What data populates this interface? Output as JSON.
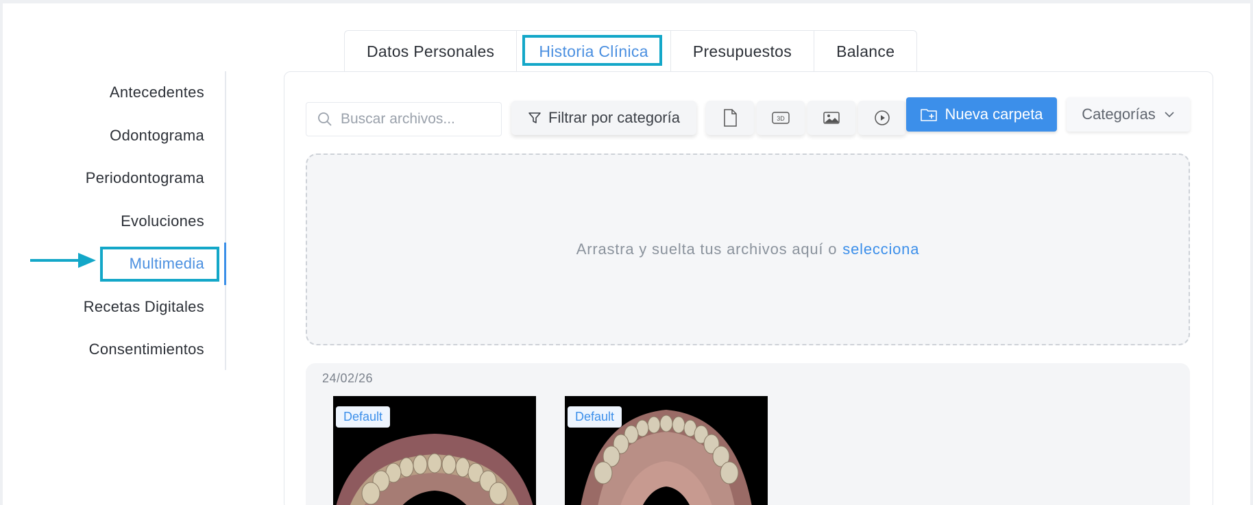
{
  "tabs": [
    {
      "label": "Datos Personales"
    },
    {
      "label": "Historia Clínica"
    },
    {
      "label": "Presupuestos"
    },
    {
      "label": "Balance"
    }
  ],
  "sidebar": {
    "items": [
      {
        "label": "Antecedentes"
      },
      {
        "label": "Odontograma"
      },
      {
        "label": "Periodontograma"
      },
      {
        "label": "Evoluciones"
      },
      {
        "label": "Multimedia"
      },
      {
        "label": "Recetas Digitales"
      },
      {
        "label": "Consentimientos"
      }
    ]
  },
  "toolbar": {
    "search_placeholder": "Buscar archivos...",
    "filter_label": "Filtrar por categoría",
    "new_folder_label": "Nueva carpeta",
    "categories_label": "Categorías"
  },
  "dropzone": {
    "text": "Arrastra y suelta tus archivos aquí o",
    "link": "selecciona"
  },
  "gallery": {
    "date": "24/02/26",
    "items": [
      {
        "badge": "Default"
      },
      {
        "badge": "Default"
      }
    ]
  },
  "colors": {
    "accent": "#3c8fea",
    "highlight": "#13a7c8"
  }
}
